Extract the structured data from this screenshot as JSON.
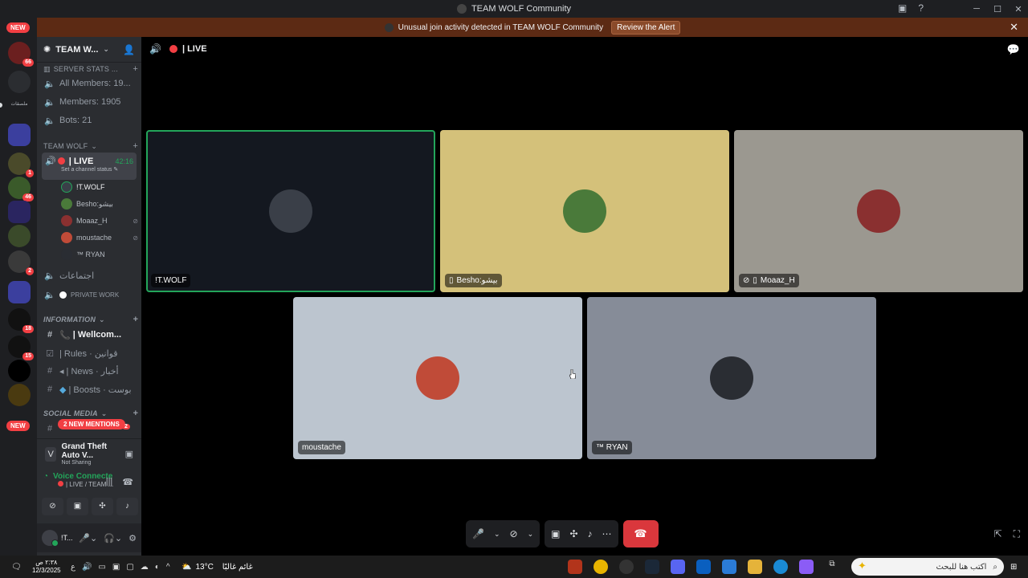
{
  "window": {
    "title": "TEAM WOLF Community"
  },
  "alert": {
    "text": "Unusual join activity detected in TEAM WOLF Community",
    "action": "Review the Alert"
  },
  "guilds": {
    "new_top": "NEW",
    "new_bottom": "NEW",
    "badges": [
      "66",
      "1",
      "46",
      "2",
      "18",
      "15"
    ],
    "folder_label": "ملصقات"
  },
  "server": {
    "name": "TEAM W..."
  },
  "channels": {
    "stats_category": "SERVER STATS ...",
    "all_members": "All Members: 19...",
    "members": "Members: 1905",
    "bots": "Bots: 21",
    "team_category": "TEAM WOLF",
    "live": {
      "name": "| LIVE",
      "timer": "42:16",
      "status": "Set a channel status"
    },
    "voice_users": [
      "!T.WOLF",
      "Besho:بيشو",
      "Moaaz_H",
      "moustache",
      "™ RYAN"
    ],
    "meetings": "اجتماعات",
    "private_work": "PRIVATE WORK",
    "info_category": "INFORMATION",
    "welcome": "| Wellcom...",
    "rules": "| Rules · قوانين",
    "news": "| News · أخبار",
    "boosts": "| Boosts · بوست",
    "social_category": "SOCIAL MEDIA",
    "mentions_pill": "2 NEW MENTIONS",
    "mentions_count": "2"
  },
  "activity": {
    "game": "Grand Theft Auto V...",
    "status": "Not Sharing"
  },
  "voice_panel": {
    "title": "Voice Connecte",
    "subtitle": "| LIVE / TEAM ..."
  },
  "user": {
    "name": "!T..."
  },
  "stage": {
    "channel": "| LIVE",
    "tiles": [
      {
        "name": "!T.WOLF",
        "bg": "#141820",
        "avatar": "#3a3f48",
        "speaking": true
      },
      {
        "name": "Besho:بيشو",
        "bg": "#d4c17a",
        "avatar": "#4a7a3a",
        "mobile": true
      },
      {
        "name": "Moaaz_H",
        "bg": "#9b9890",
        "avatar": "#8a3030",
        "mobile": true,
        "muted_video": true
      },
      {
        "name": "moustache",
        "bg": "#bcc5cf",
        "avatar": "#c04b38"
      },
      {
        "name": "™ RYAN",
        "bg": "#868c98",
        "avatar": "#2a2d33"
      }
    ]
  },
  "taskbar": {
    "time": "٢:٣٨ ص",
    "date": "12/3/2025",
    "weather": "13°C",
    "weather_text": "غائم غالبًا",
    "search_placeholder": "اكتب هنا للبحث"
  },
  "colors": {
    "accent_green": "#23a55a",
    "danger": "#da373c",
    "alert_bg": "#5c2a14"
  }
}
